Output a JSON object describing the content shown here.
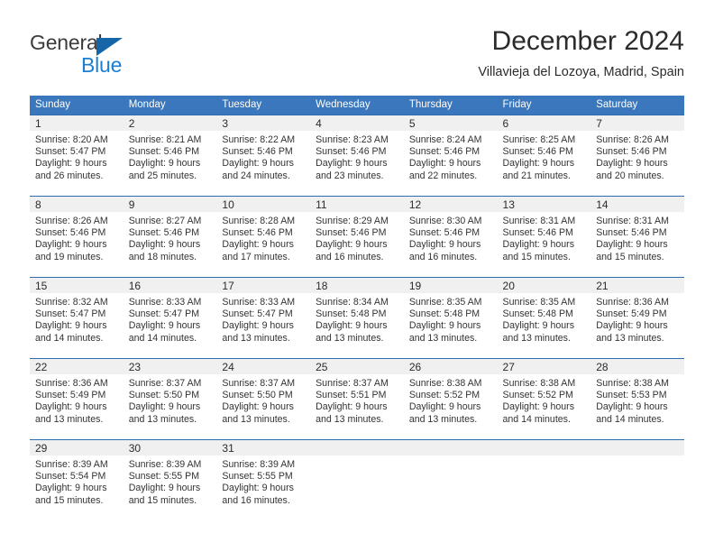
{
  "brand": {
    "name_top": "General",
    "name_bottom": "Blue",
    "flag_icon": "triangle-flag-icon",
    "accent_dark": "#1565a8",
    "accent_light": "#1a7fd4"
  },
  "header": {
    "title": "December 2024",
    "subtitle": "Villavieja del Lozoya, Madrid, Spain"
  },
  "theme": {
    "header_row_bg": "#3b77bc",
    "daynum_bg": "#f0f0f0",
    "daynum_rule": "#2f6cae"
  },
  "weekdays": [
    "Sunday",
    "Monday",
    "Tuesday",
    "Wednesday",
    "Thursday",
    "Friday",
    "Saturday"
  ],
  "weeks": [
    [
      {
        "day": "1",
        "sunrise": "Sunrise: 8:20 AM",
        "sunset": "Sunset: 5:47 PM",
        "daylight1": "Daylight: 9 hours",
        "daylight2": "and 26 minutes."
      },
      {
        "day": "2",
        "sunrise": "Sunrise: 8:21 AM",
        "sunset": "Sunset: 5:46 PM",
        "daylight1": "Daylight: 9 hours",
        "daylight2": "and 25 minutes."
      },
      {
        "day": "3",
        "sunrise": "Sunrise: 8:22 AM",
        "sunset": "Sunset: 5:46 PM",
        "daylight1": "Daylight: 9 hours",
        "daylight2": "and 24 minutes."
      },
      {
        "day": "4",
        "sunrise": "Sunrise: 8:23 AM",
        "sunset": "Sunset: 5:46 PM",
        "daylight1": "Daylight: 9 hours",
        "daylight2": "and 23 minutes."
      },
      {
        "day": "5",
        "sunrise": "Sunrise: 8:24 AM",
        "sunset": "Sunset: 5:46 PM",
        "daylight1": "Daylight: 9 hours",
        "daylight2": "and 22 minutes."
      },
      {
        "day": "6",
        "sunrise": "Sunrise: 8:25 AM",
        "sunset": "Sunset: 5:46 PM",
        "daylight1": "Daylight: 9 hours",
        "daylight2": "and 21 minutes."
      },
      {
        "day": "7",
        "sunrise": "Sunrise: 8:26 AM",
        "sunset": "Sunset: 5:46 PM",
        "daylight1": "Daylight: 9 hours",
        "daylight2": "and 20 minutes."
      }
    ],
    [
      {
        "day": "8",
        "sunrise": "Sunrise: 8:26 AM",
        "sunset": "Sunset: 5:46 PM",
        "daylight1": "Daylight: 9 hours",
        "daylight2": "and 19 minutes."
      },
      {
        "day": "9",
        "sunrise": "Sunrise: 8:27 AM",
        "sunset": "Sunset: 5:46 PM",
        "daylight1": "Daylight: 9 hours",
        "daylight2": "and 18 minutes."
      },
      {
        "day": "10",
        "sunrise": "Sunrise: 8:28 AM",
        "sunset": "Sunset: 5:46 PM",
        "daylight1": "Daylight: 9 hours",
        "daylight2": "and 17 minutes."
      },
      {
        "day": "11",
        "sunrise": "Sunrise: 8:29 AM",
        "sunset": "Sunset: 5:46 PM",
        "daylight1": "Daylight: 9 hours",
        "daylight2": "and 16 minutes."
      },
      {
        "day": "12",
        "sunrise": "Sunrise: 8:30 AM",
        "sunset": "Sunset: 5:46 PM",
        "daylight1": "Daylight: 9 hours",
        "daylight2": "and 16 minutes."
      },
      {
        "day": "13",
        "sunrise": "Sunrise: 8:31 AM",
        "sunset": "Sunset: 5:46 PM",
        "daylight1": "Daylight: 9 hours",
        "daylight2": "and 15 minutes."
      },
      {
        "day": "14",
        "sunrise": "Sunrise: 8:31 AM",
        "sunset": "Sunset: 5:46 PM",
        "daylight1": "Daylight: 9 hours",
        "daylight2": "and 15 minutes."
      }
    ],
    [
      {
        "day": "15",
        "sunrise": "Sunrise: 8:32 AM",
        "sunset": "Sunset: 5:47 PM",
        "daylight1": "Daylight: 9 hours",
        "daylight2": "and 14 minutes."
      },
      {
        "day": "16",
        "sunrise": "Sunrise: 8:33 AM",
        "sunset": "Sunset: 5:47 PM",
        "daylight1": "Daylight: 9 hours",
        "daylight2": "and 14 minutes."
      },
      {
        "day": "17",
        "sunrise": "Sunrise: 8:33 AM",
        "sunset": "Sunset: 5:47 PM",
        "daylight1": "Daylight: 9 hours",
        "daylight2": "and 13 minutes."
      },
      {
        "day": "18",
        "sunrise": "Sunrise: 8:34 AM",
        "sunset": "Sunset: 5:48 PM",
        "daylight1": "Daylight: 9 hours",
        "daylight2": "and 13 minutes."
      },
      {
        "day": "19",
        "sunrise": "Sunrise: 8:35 AM",
        "sunset": "Sunset: 5:48 PM",
        "daylight1": "Daylight: 9 hours",
        "daylight2": "and 13 minutes."
      },
      {
        "day": "20",
        "sunrise": "Sunrise: 8:35 AM",
        "sunset": "Sunset: 5:48 PM",
        "daylight1": "Daylight: 9 hours",
        "daylight2": "and 13 minutes."
      },
      {
        "day": "21",
        "sunrise": "Sunrise: 8:36 AM",
        "sunset": "Sunset: 5:49 PM",
        "daylight1": "Daylight: 9 hours",
        "daylight2": "and 13 minutes."
      }
    ],
    [
      {
        "day": "22",
        "sunrise": "Sunrise: 8:36 AM",
        "sunset": "Sunset: 5:49 PM",
        "daylight1": "Daylight: 9 hours",
        "daylight2": "and 13 minutes."
      },
      {
        "day": "23",
        "sunrise": "Sunrise: 8:37 AM",
        "sunset": "Sunset: 5:50 PM",
        "daylight1": "Daylight: 9 hours",
        "daylight2": "and 13 minutes."
      },
      {
        "day": "24",
        "sunrise": "Sunrise: 8:37 AM",
        "sunset": "Sunset: 5:50 PM",
        "daylight1": "Daylight: 9 hours",
        "daylight2": "and 13 minutes."
      },
      {
        "day": "25",
        "sunrise": "Sunrise: 8:37 AM",
        "sunset": "Sunset: 5:51 PM",
        "daylight1": "Daylight: 9 hours",
        "daylight2": "and 13 minutes."
      },
      {
        "day": "26",
        "sunrise": "Sunrise: 8:38 AM",
        "sunset": "Sunset: 5:52 PM",
        "daylight1": "Daylight: 9 hours",
        "daylight2": "and 13 minutes."
      },
      {
        "day": "27",
        "sunrise": "Sunrise: 8:38 AM",
        "sunset": "Sunset: 5:52 PM",
        "daylight1": "Daylight: 9 hours",
        "daylight2": "and 14 minutes."
      },
      {
        "day": "28",
        "sunrise": "Sunrise: 8:38 AM",
        "sunset": "Sunset: 5:53 PM",
        "daylight1": "Daylight: 9 hours",
        "daylight2": "and 14 minutes."
      }
    ],
    [
      {
        "day": "29",
        "sunrise": "Sunrise: 8:39 AM",
        "sunset": "Sunset: 5:54 PM",
        "daylight1": "Daylight: 9 hours",
        "daylight2": "and 15 minutes."
      },
      {
        "day": "30",
        "sunrise": "Sunrise: 8:39 AM",
        "sunset": "Sunset: 5:55 PM",
        "daylight1": "Daylight: 9 hours",
        "daylight2": "and 15 minutes."
      },
      {
        "day": "31",
        "sunrise": "Sunrise: 8:39 AM",
        "sunset": "Sunset: 5:55 PM",
        "daylight1": "Daylight: 9 hours",
        "daylight2": "and 16 minutes."
      },
      {
        "day": "",
        "sunrise": "",
        "sunset": "",
        "daylight1": "",
        "daylight2": ""
      },
      {
        "day": "",
        "sunrise": "",
        "sunset": "",
        "daylight1": "",
        "daylight2": ""
      },
      {
        "day": "",
        "sunrise": "",
        "sunset": "",
        "daylight1": "",
        "daylight2": ""
      },
      {
        "day": "",
        "sunrise": "",
        "sunset": "",
        "daylight1": "",
        "daylight2": ""
      }
    ]
  ]
}
